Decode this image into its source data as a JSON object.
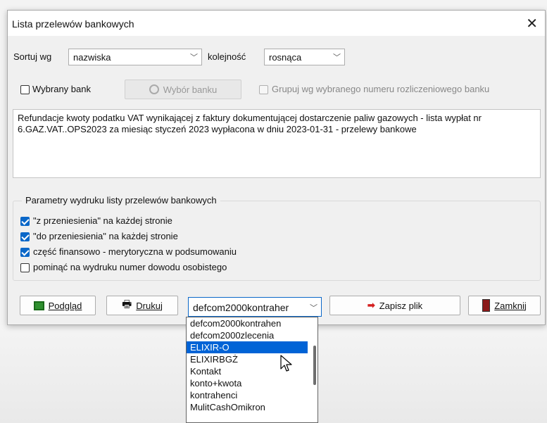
{
  "dialog": {
    "title": "Lista przelewów bankowych"
  },
  "sort": {
    "label": "Sortuj wg",
    "sort_value": "nazwiska",
    "order_label": "kolejność",
    "order_value": "rosnąca"
  },
  "bank": {
    "selected_bank_label": "Wybrany bank",
    "choose_bank_button": "Wybór banku",
    "group_by_label": "Grupuj wg wybranego numeru rozliczeniowego banku"
  },
  "description": "Refundacje kwoty podatku VAT wynikającej z faktury dokumentującej dostarczenie paliw gazowych - lista wypłat nr 6.GAZ.VAT..OPS2023 za miesiąc styczeń 2023 wypłacona w dniu 2023-01-31 - przelewy bankowe",
  "print_params": {
    "title": "Parametry wydruku listy przelewów bankowych",
    "options": [
      {
        "label": "\"z przeniesienia\" na każdej stronie",
        "checked": true
      },
      {
        "label": "\"do przeniesienia\" na każdej stronie",
        "checked": true
      },
      {
        "label": "część finansowo - merytoryczna w podsumowaniu",
        "checked": true
      },
      {
        "label": "pominąć na wydruku numer dowodu osobistego",
        "checked": false
      }
    ]
  },
  "buttons": {
    "preview": "Podgląd",
    "print": "Drukuj",
    "save_file": "Zapisz plik",
    "close": "Zamknij"
  },
  "format_select": {
    "value": "defcom2000kontraher",
    "options": [
      "defcom2000kontrahen",
      "defcom2000zlecenia",
      "ELIXIR-O",
      "ELIXIRBGŻ",
      "Kontakt",
      "konto+kwota",
      "kontrahenci",
      "MulitCashOmikron"
    ],
    "highlighted_index": 2
  },
  "colors": {
    "accent": "#0063d6",
    "checkbox": "#0a67c8"
  }
}
